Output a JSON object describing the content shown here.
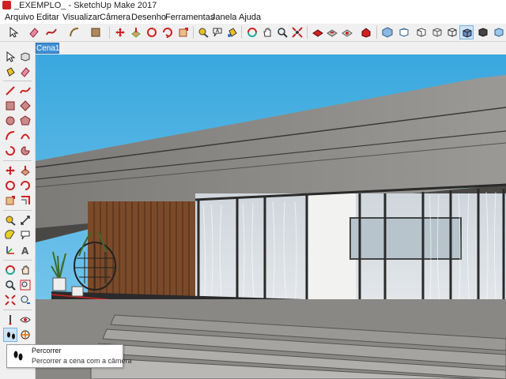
{
  "window": {
    "title": "_EXEMPLO_ - SketchUp Make 2017"
  },
  "menu": [
    "Arquivo",
    "Editar",
    "Visualizar",
    "Câmera",
    "Desenho",
    "Ferramentas",
    "Janela",
    "Ajuda"
  ],
  "scenes": {
    "active_tab": "Cena1"
  },
  "tooltip": {
    "title": "Percorrer",
    "description": "Percorrer a cena com a câmera"
  },
  "colors": {
    "sky": "#4fb3e3",
    "scene_tab": "#3f8fd6",
    "selected_tool": "#cce4f7",
    "axis_red": "#d22020"
  }
}
